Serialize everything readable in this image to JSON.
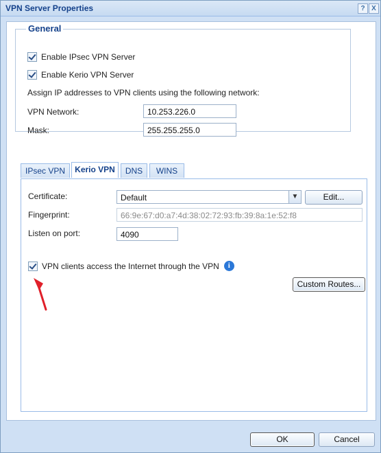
{
  "window": {
    "title": "VPN Server Properties",
    "help_label": "?",
    "close_label": "X"
  },
  "general": {
    "legend": "General",
    "enable_ipsec": {
      "label": "Enable IPsec VPN Server",
      "checked": true
    },
    "enable_kerio": {
      "label": "Enable Kerio VPN Server",
      "checked": true
    },
    "assign_text": "Assign IP addresses to VPN clients using the following network:",
    "vpn_network_label": "VPN Network:",
    "vpn_network_value": "10.253.226.0",
    "mask_label": "Mask:",
    "mask_value": "255.255.255.0"
  },
  "tabs": [
    {
      "label": "IPsec VPN",
      "active": false
    },
    {
      "label": "Kerio VPN",
      "active": true
    },
    {
      "label": "DNS",
      "active": false
    },
    {
      "label": "WINS",
      "active": false
    }
  ],
  "kerio": {
    "certificate_label": "Certificate:",
    "certificate_value": "Default",
    "edit_label": "Edit...",
    "fingerprint_label": "Fingerprint:",
    "fingerprint_value": "66:9e:67:d0:a7:4d:38:02:72:93:fb:39:8a:1e:52:f8",
    "listen_label": "Listen on port:",
    "listen_value": "4090",
    "internet_through_vpn": {
      "label": "VPN clients access the Internet through the VPN",
      "checked": true
    },
    "info_glyph": "i",
    "custom_routes_label": "Custom Routes..."
  },
  "footer": {
    "ok_label": "OK",
    "cancel_label": "Cancel"
  },
  "colors": {
    "title_text": "#15428b",
    "dialog_bg": "#cfe0f4",
    "annotation_arrow": "#e0202a",
    "info_icon": "#2b78d8"
  }
}
